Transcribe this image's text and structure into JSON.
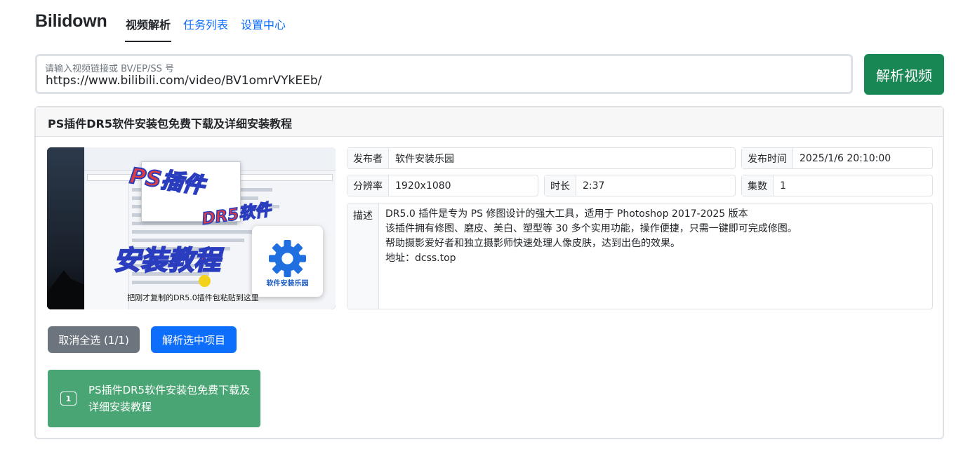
{
  "app": {
    "brand": "Bilidown",
    "nav": [
      {
        "label": "视频解析",
        "active": true
      },
      {
        "label": "任务列表",
        "active": false
      },
      {
        "label": "设置中心",
        "active": false
      }
    ]
  },
  "search": {
    "label": "请输入视频链接或 BV/EP/SS 号",
    "value": "https://www.bilibili.com/video/BV1omrVYkEEb/",
    "button": "解析视频"
  },
  "video": {
    "title": "PS插件DR5软件安装包免费下载及详细安装教程",
    "thumbnail": {
      "overlay_line1": "PS插件",
      "overlay_line2": "DR5软件",
      "overlay_line3": "安装教程",
      "logo_text": "软件安装乐园",
      "caption": "把刚才复制的DR5.0插件包粘贴到这里"
    },
    "fields": {
      "publisher_label": "发布者",
      "publisher": "软件安装乐园",
      "pubtime_label": "发布时间",
      "pubtime": "2025/1/6 20:10:00",
      "resolution_label": "分辨率",
      "resolution": "1920x1080",
      "duration_label": "时长",
      "duration": "2:37",
      "episodes_label": "集数",
      "episodes": "1",
      "desc_label": "描述",
      "desc_lines": [
        "DR5.0 插件是专为 PS 修图设计的强大工具，适用于 Photoshop 2017-2025 版本",
        "该插件拥有修图、磨皮、美白、塑型等 30 多个实用功能，操作便捷，只需一键即可完成修图。",
        "帮助摄影爱好者和独立摄影师快速处理人像皮肤，达到出色的效果。",
        "地址：dcss.top"
      ]
    },
    "actions": {
      "deselect": "取消全选 (1/1)",
      "parse_selected": "解析选中项目"
    },
    "items": [
      {
        "index": "1",
        "title": "PS插件DR5软件安装包免费下载及详细安装教程"
      }
    ]
  },
  "colors": {
    "primary": "#0d6efd",
    "success": "#198754",
    "secondary": "#6c757d",
    "item_selected": "#4aa574"
  }
}
